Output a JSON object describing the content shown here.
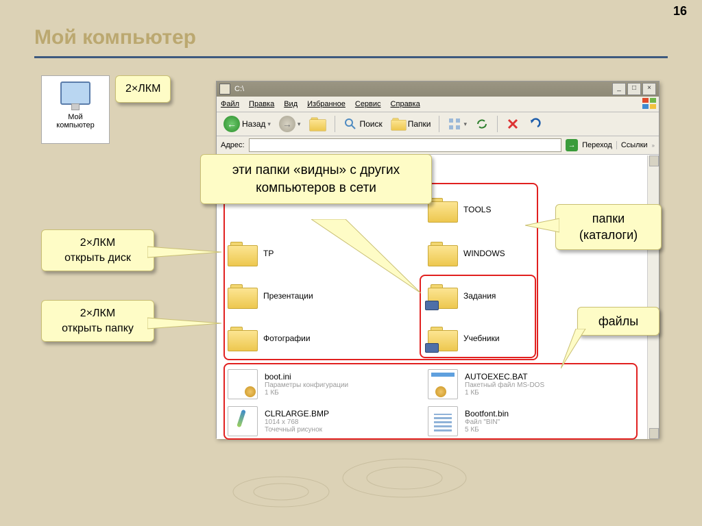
{
  "page_number": "16",
  "slide_title": "Мой компьютер",
  "desktop_icon_label": "Мой\nкомпьютер",
  "callouts": {
    "dblclick": "2×ЛКМ",
    "open_disk": "2×ЛКМ\nоткрыть диск",
    "open_folder": "2×ЛКМ\nоткрыть папку",
    "network_visible": "эти папки «видны» с других компьютеров в сети",
    "folders_label": "папки\n(каталоги)",
    "files_label": "файлы"
  },
  "window": {
    "title": "C:\\",
    "menu": [
      "Файл",
      "Правка",
      "Вид",
      "Избранное",
      "Сервис",
      "Справка"
    ],
    "toolbar": {
      "back": "Назад",
      "search": "Поиск",
      "folders": "Папки"
    },
    "addrbar": {
      "label": "Адрес:",
      "go": "Переход",
      "links": "Ссылки"
    }
  },
  "folders": {
    "col1": [
      "TP",
      "Презентации",
      "Фотографии"
    ],
    "col2": [
      "TOOLS",
      "WINDOWS",
      "Задания",
      "Учебники"
    ]
  },
  "files": {
    "f1": {
      "name": "boot.ini",
      "d1": "Параметры конфигурации",
      "d2": "1 КБ"
    },
    "f2": {
      "name": "AUTOEXEC.BAT",
      "d1": "Пакетный файл MS-DOS",
      "d2": "1 КБ"
    },
    "f3": {
      "name": "CLRLARGE.BMP",
      "d1": "1014 x 768",
      "d2": "Точечный рисунок"
    },
    "f4": {
      "name": "Bootfont.bin",
      "d1": "Файл \"BIN\"",
      "d2": "5 КБ"
    }
  }
}
